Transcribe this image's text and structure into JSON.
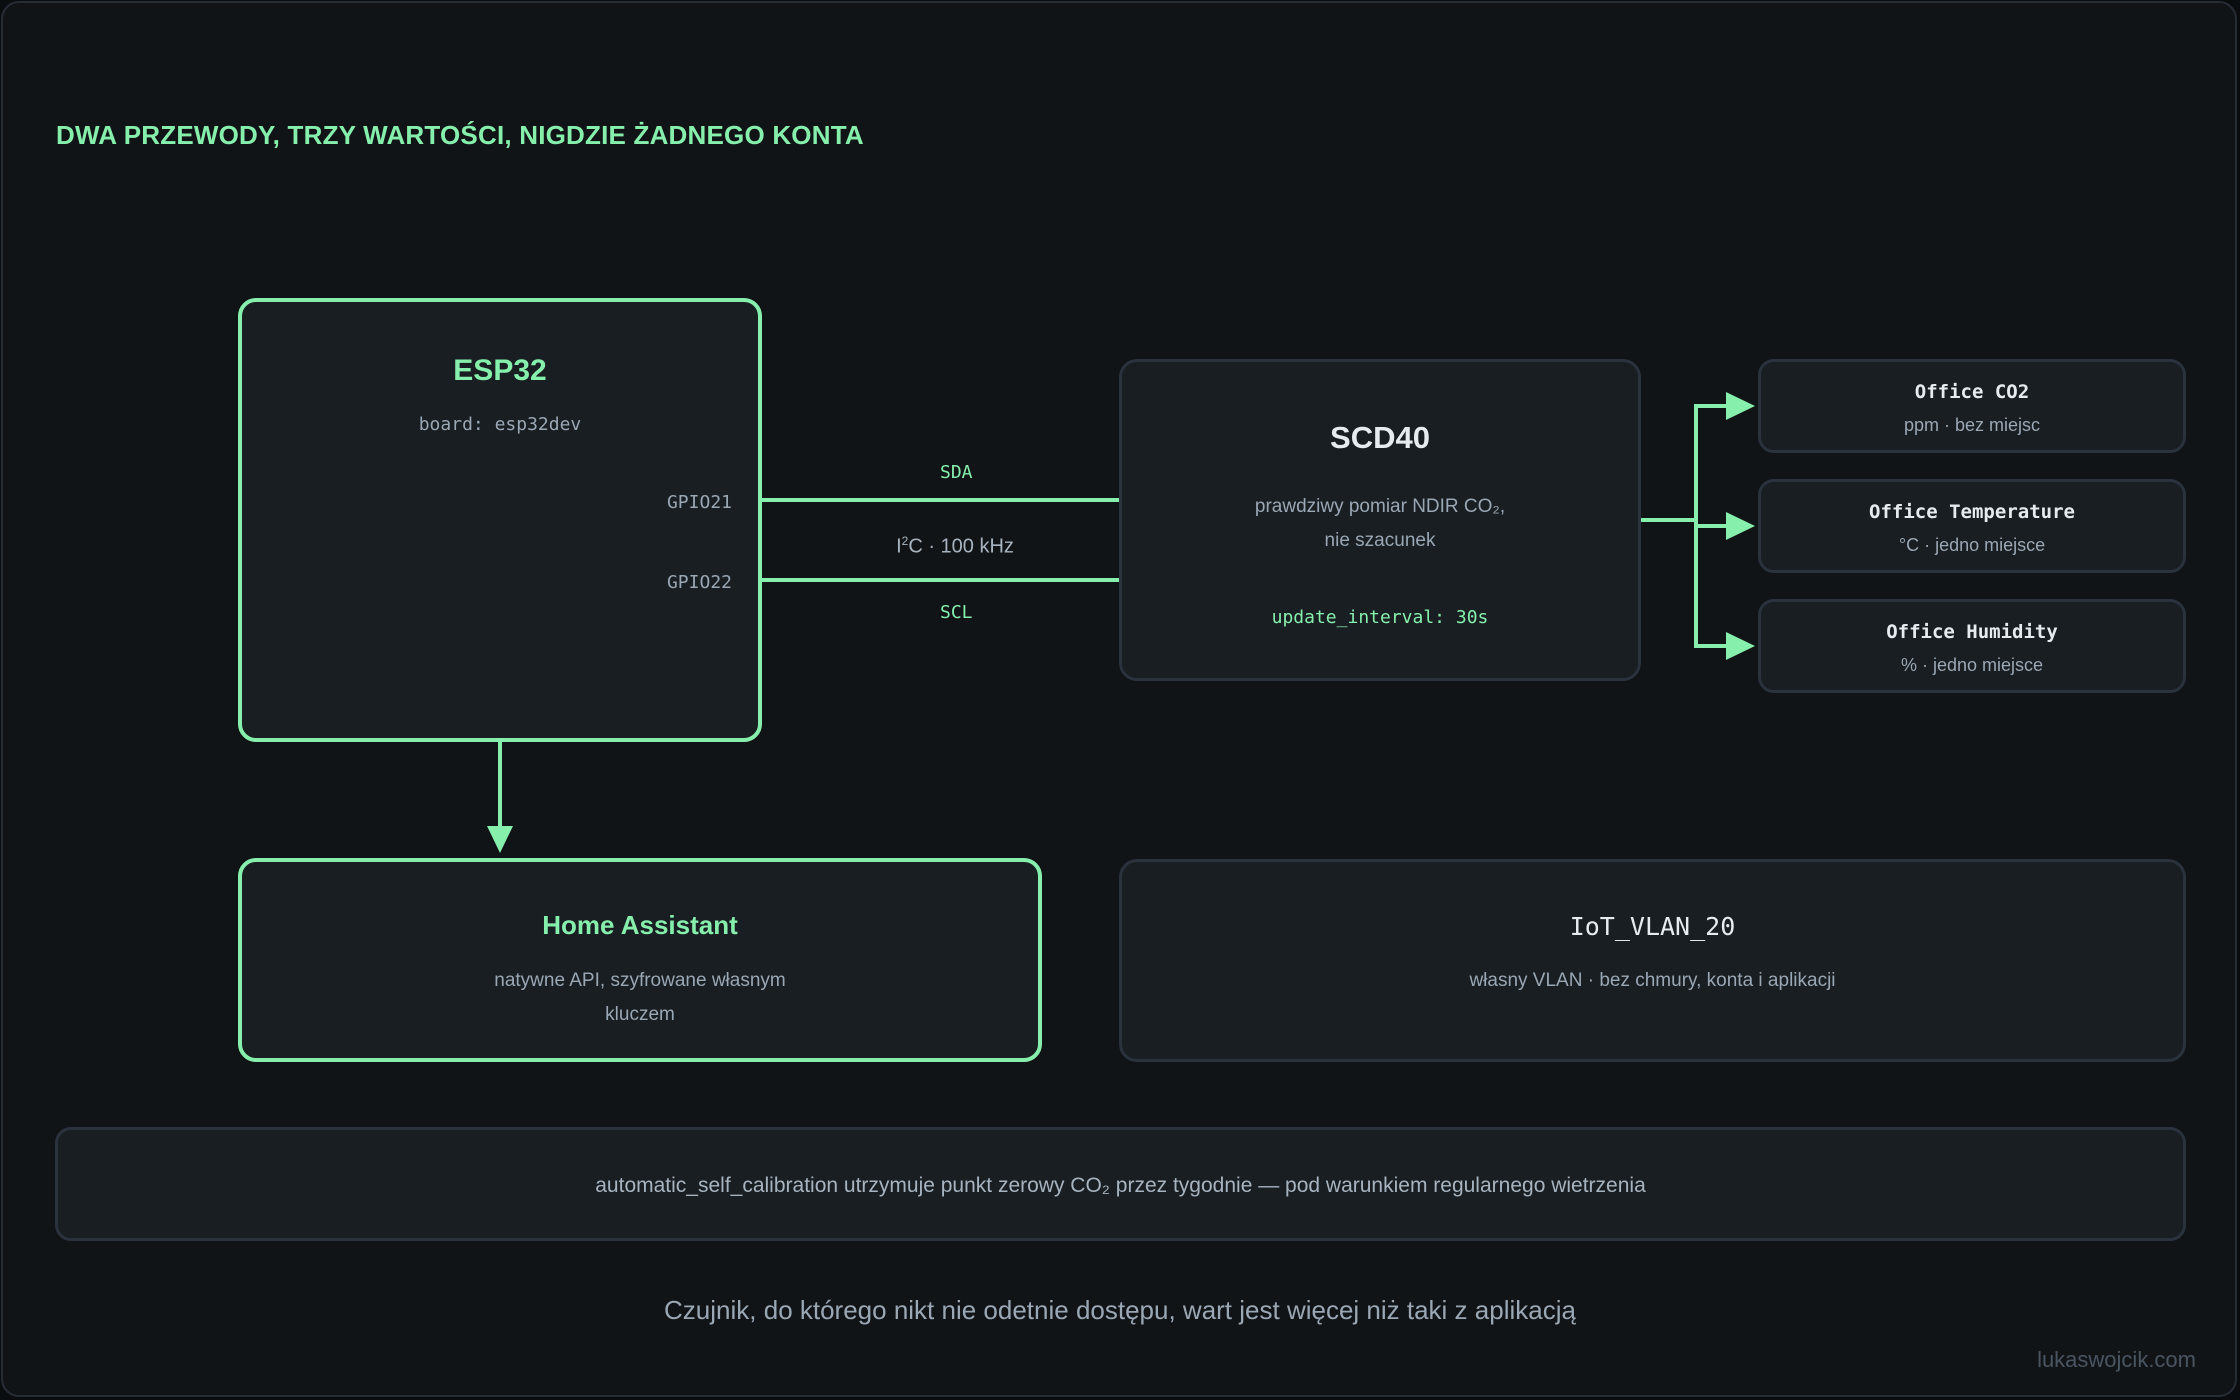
{
  "diagram": {
    "title": "DWA PRZEWODY, TRZY WARTOŚCI, NIGDZIE ŻADNEGO KONTA",
    "esp32": {
      "name": "ESP32",
      "board": "board: esp32dev",
      "pin_sda": "GPIO21",
      "pin_scl": "GPIO22"
    },
    "bus": {
      "sda_label": "SDA",
      "scl_label": "SCL",
      "protocol_prefix": "I",
      "protocol_sup": "2",
      "protocol_rest": "C · 100 kHz"
    },
    "scd40": {
      "name": "SCD40",
      "desc_line1": "prawdziwy pomiar NDIR CO₂,",
      "desc_line2": "nie szacunek",
      "interval": "update_interval: 30s"
    },
    "outputs": [
      {
        "title": "Office CO2",
        "sub": "ppm · bez miejsc"
      },
      {
        "title": "Office Temperature",
        "sub": "°C · jedno miejsce"
      },
      {
        "title": "Office Humidity",
        "sub": "% · jedno miejsce"
      }
    ],
    "home_assistant": {
      "name": "Home Assistant",
      "desc_line1": "natywne API, szyfrowane własnym",
      "desc_line2": "kluczem"
    },
    "vlan": {
      "name": "IoT_VLAN_20",
      "desc": "własny VLAN · bez chmury, konta i aplikacji"
    },
    "note": "automatic_self_calibration utrzymuje punkt zerowy CO₂ przez tygodnie — pod warunkiem regularnego wietrzenia",
    "footer": "Czujnik, do którego nikt nie odetnie dostępu, wart jest więcej niż taki z aplikacją",
    "credit": "lukaswojcik.com",
    "colors": {
      "accent": "#86efac",
      "background": "#101417",
      "box": "#181e22",
      "border_gray": "#2a323d",
      "text_muted": "#9aa7b4"
    }
  }
}
